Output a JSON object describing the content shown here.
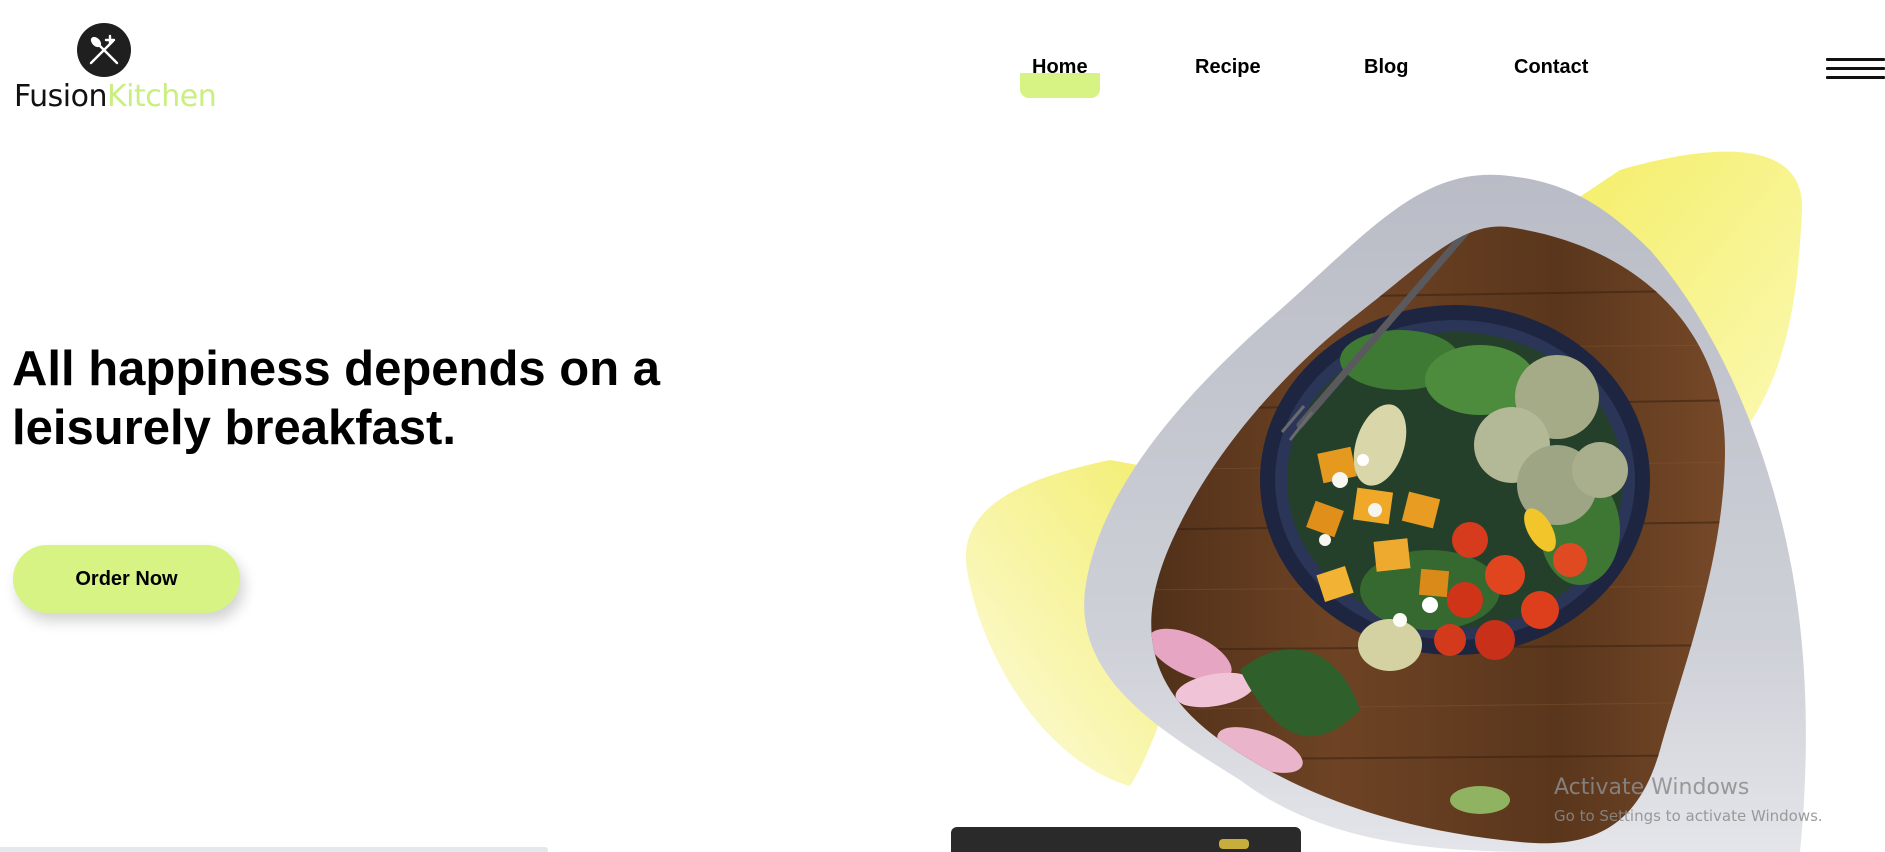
{
  "brand": {
    "name_part1": "Fusion",
    "name_part2": "Kitchen",
    "accent_color": "#d6f384",
    "logo_icon": "crossed-fork-knife-icon"
  },
  "nav": {
    "items": [
      {
        "label": "Home",
        "active": true
      },
      {
        "label": "Recipe",
        "active": false
      },
      {
        "label": "Blog",
        "active": false
      },
      {
        "label": "Contact",
        "active": false
      }
    ],
    "menu_icon": "hamburger-menu-icon"
  },
  "hero": {
    "title_line1": "All happiness depends on a",
    "title_line2": "leisurely breakfast.",
    "cta_label": "Order Now"
  },
  "watermark": {
    "line1": "Activate Windows",
    "line2": "Go to Settings to activate Windows."
  }
}
